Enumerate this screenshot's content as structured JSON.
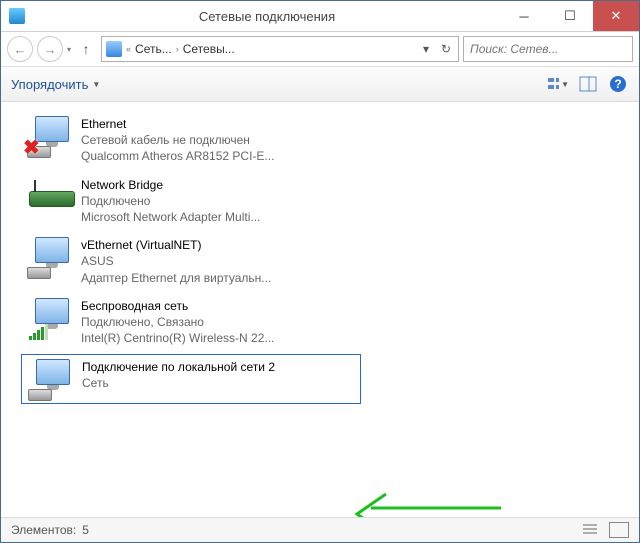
{
  "window": {
    "title": "Сетевые подключения"
  },
  "nav": {
    "crumb1": "Сеть...",
    "crumb2": "Сетевы..."
  },
  "search": {
    "placeholder": "Поиск: Сетев..."
  },
  "toolbar": {
    "organize": "Упорядочить"
  },
  "connections": [
    {
      "name": "Ethernet",
      "status": "Сетевой кабель не подключен",
      "device": "Qualcomm Atheros AR8152 PCI-E...",
      "icon": "ethernet-disconnected"
    },
    {
      "name": "Network Bridge",
      "status": "Подключено",
      "device": "Microsoft Network Adapter Multi...",
      "icon": "bridge"
    },
    {
      "name": "vEthernet (VirtualNET)",
      "status": "ASUS",
      "device": "Адаптер Ethernet для виртуальн...",
      "icon": "ethernet"
    },
    {
      "name": "Беспроводная сеть",
      "status": "Подключено, Связано",
      "device": "Intel(R) Centrino(R) Wireless-N 22...",
      "icon": "wifi"
    },
    {
      "name": "Подключение по локальной сети 2",
      "status": "",
      "device": "Сеть",
      "icon": "ethernet",
      "selected": true
    }
  ],
  "status": {
    "label": "Элементов:",
    "count": "5"
  }
}
